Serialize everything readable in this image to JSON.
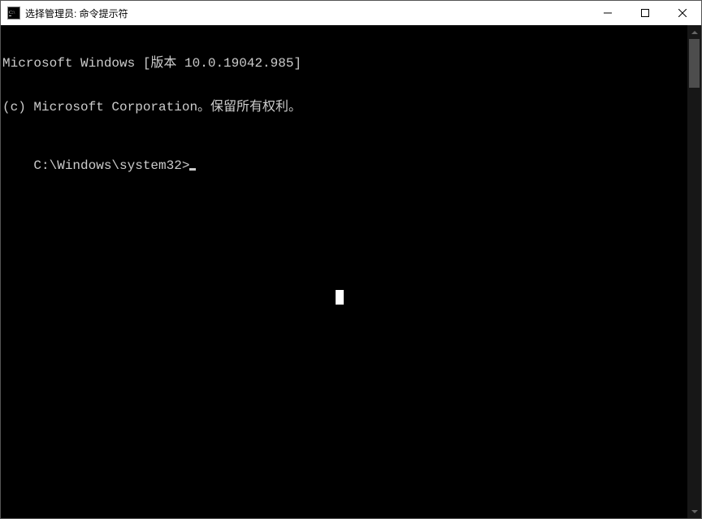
{
  "window": {
    "title": "选择管理员: 命令提示符"
  },
  "terminal": {
    "line1": "Microsoft Windows [版本 10.0.19042.985]",
    "line2": "(c) Microsoft Corporation。保留所有权利。",
    "blank": "",
    "prompt": "C:\\Windows\\system32>"
  }
}
